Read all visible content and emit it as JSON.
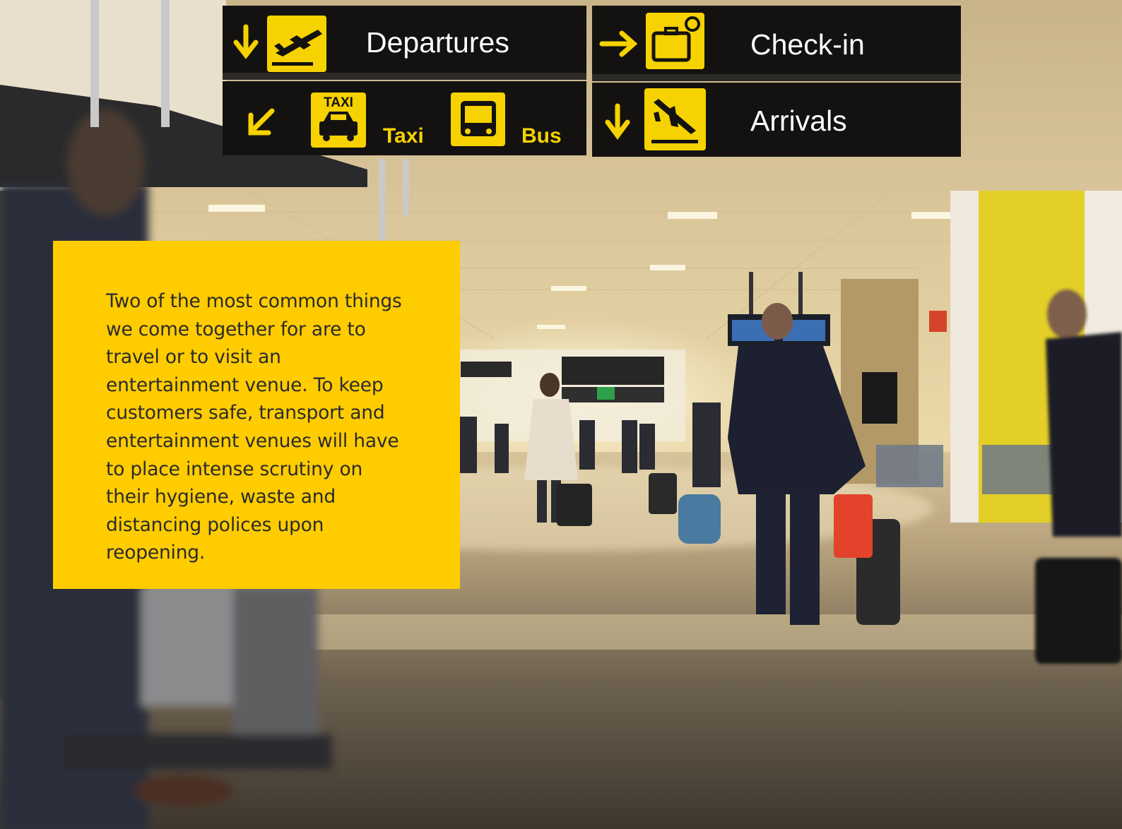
{
  "signs": {
    "departures": "Departures",
    "checkin": "Check-in",
    "arrivals": "Arrivals",
    "taxi_badge": "TAXI",
    "taxi": "Taxi",
    "bus": "Bus"
  },
  "callout": {
    "text": "Two of the most common things we come together for are to travel or to visit an entertainment venue. To keep customers safe, transport and entertainment venues will have to place intense scrutiny on their hygiene, waste and distancing polices upon reopening."
  },
  "colors": {
    "callout_bg": "#ffcc00",
    "sign_bg": "#141210",
    "sign_yellow": "#f5d200"
  }
}
